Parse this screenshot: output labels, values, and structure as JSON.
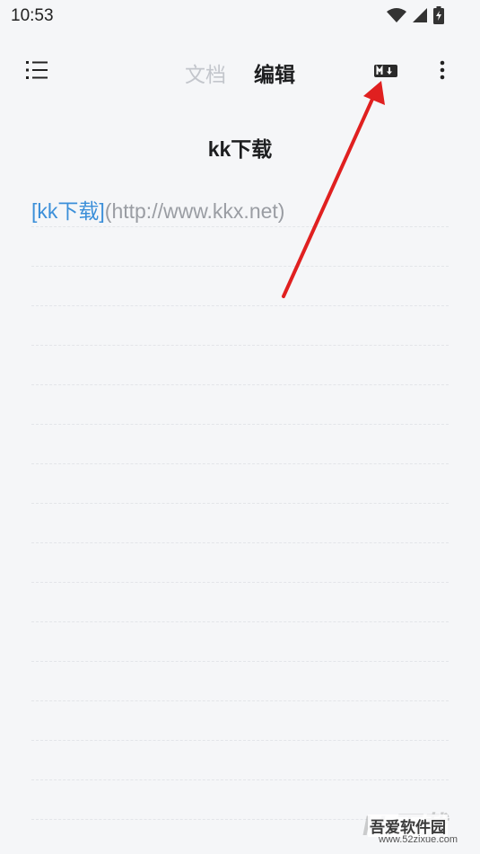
{
  "status_bar": {
    "time": "10:53",
    "icons": [
      "wifi-icon",
      "signal-icon",
      "battery-charging-icon"
    ]
  },
  "toolbar": {
    "menu_icon": "list-icon",
    "tabs": [
      {
        "label": "文档",
        "active": false
      },
      {
        "label": "编辑",
        "active": true
      }
    ],
    "markdown_icon": "markdown-icon",
    "more_icon": "more-vertical-icon"
  },
  "document": {
    "title": "kk下载",
    "lines": [
      {
        "link_text": "[kk下载]",
        "url_text": "(http://www.kkx.net)"
      }
    ]
  },
  "colors": {
    "background": "#f5f6f8",
    "link": "#3b8fd9",
    "url": "#9a9da3",
    "inactive_tab": "#c3c6cc",
    "annotation_arrow": "#e02020"
  },
  "watermark": {
    "logo": "kk下载",
    "name": "吾爱软件园",
    "site": "www.52zixue.com"
  }
}
